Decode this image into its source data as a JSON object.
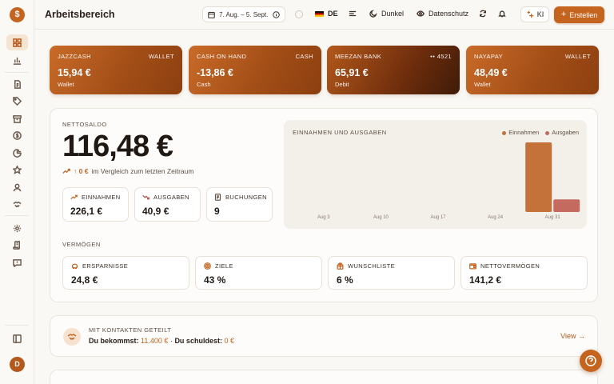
{
  "app": {
    "logo": "$",
    "user_initial": "D"
  },
  "topbar": {
    "title": "Arbeitsbereich",
    "date_range": "7. Aug. – 5. Sept.",
    "language": "DE",
    "theme_label": "Dunkel",
    "privacy_label": "Datenschutz",
    "ai_label": "KI",
    "create_label": "Erstellen"
  },
  "accounts": [
    {
      "name": "JAZZCASH",
      "type_tag": "WALLET",
      "amount": "15,94 €",
      "sub": "Wallet",
      "dark": false
    },
    {
      "name": "CASH ON HAND",
      "type_tag": "CASH",
      "amount": "-13,86 €",
      "sub": "Cash",
      "dark": false
    },
    {
      "name": "MEEZAN BANK",
      "type_tag": "•• 4521",
      "amount": "65,91 €",
      "sub": "Debit",
      "dark": true
    },
    {
      "name": "NAYAPAY",
      "type_tag": "WALLET",
      "amount": "48,49 €",
      "sub": "Wallet",
      "dark": false
    }
  ],
  "summary": {
    "net_label": "NETTOSALDO",
    "net_value": "116,48 €",
    "change_value": "↑ 0 €",
    "change_text": "im Vergleich zum letzten Zeitraum",
    "stats": [
      {
        "label": "EINNAHMEN",
        "value": "226,1 €"
      },
      {
        "label": "AUSGABEN",
        "value": "40,9 €"
      },
      {
        "label": "BUCHUNGEN",
        "value": "9"
      }
    ]
  },
  "chart": {
    "title": "EINNAHMEN UND AUSGABEN",
    "legend_income": "Einnahmen",
    "legend_expense": "Ausgaben",
    "colors": {
      "income": "#c4713a",
      "expense": "#c46a5e"
    }
  },
  "chart_data": {
    "type": "bar",
    "title": "EINNAHMEN UND AUSGABEN",
    "categories": [
      "Aug 3",
      "Aug 10",
      "Aug 17",
      "Aug 24",
      "Aug 31"
    ],
    "series": [
      {
        "name": "Einnahmen",
        "values": [
          0,
          0,
          0,
          0,
          226.1
        ]
      },
      {
        "name": "Ausgaben",
        "values": [
          0,
          0,
          0,
          0,
          40.9
        ]
      }
    ],
    "grid": false,
    "legend": "top-right"
  },
  "assets": {
    "label": "VERMÖGEN",
    "items": [
      {
        "label": "ERSPARNISSE",
        "value": "24,8 €",
        "icon": "piggy-bank-icon"
      },
      {
        "label": "ZIELE",
        "value": "43 %",
        "icon": "target-icon"
      },
      {
        "label": "WUNSCHLISTE",
        "value": "6 %",
        "icon": "gift-icon"
      },
      {
        "label": "NETTOVERMÖGEN",
        "value": "141,2 €",
        "icon": "wallet-icon"
      }
    ]
  },
  "shared": {
    "title": "MIT KONTAKTEN GETEILT",
    "receive_label": "Du bekommst:",
    "receive_value": "11.400 €",
    "separator": "·",
    "owe_label": "Du schuldest:",
    "owe_value": "0 €",
    "view_label": "View →"
  }
}
